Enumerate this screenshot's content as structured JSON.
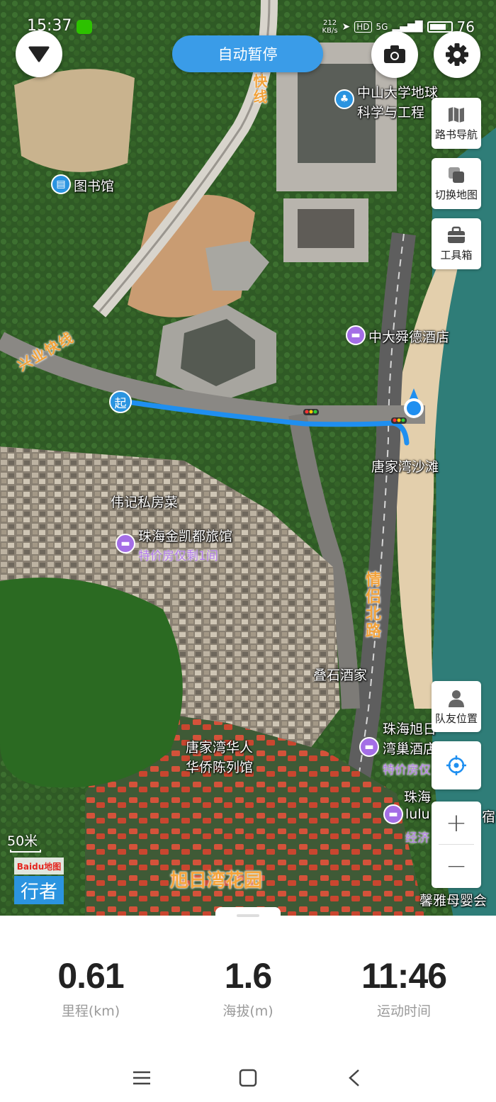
{
  "status_bar": {
    "time": "15:37",
    "net_speed": "212\nKB/s",
    "hd": "HD",
    "network": "5G",
    "battery": "76"
  },
  "top": {
    "pause_label": "自动暂停"
  },
  "side_tools": {
    "roadbook": "路书导航",
    "switch_map": "切换地图",
    "toolbox": "工具箱",
    "teammate": "队友位置"
  },
  "map": {
    "labels": {
      "library": "图书馆",
      "sysu_line1": "中山大学地球",
      "sysu_line2": "科学与工程",
      "express": "快线",
      "xingye": "兴业快线",
      "hotel_shunde": "中大舜德酒店",
      "start_marker": "起",
      "beach": "唐家湾沙滩",
      "weiji": "伟记私房菜",
      "jinkaidu": "珠海金凯都旅馆",
      "jinkaidu_offer": "特价房仅剩1间",
      "qinglv_road": "情侣北路",
      "dieshi": "叠石酒家",
      "xuri_hotel_1": "珠海旭日",
      "xuri_hotel_2": "湾巢酒店",
      "xuri_offer": "特价房仅",
      "museum_line1": "唐家湾华人",
      "museum_line2": "华侨陈列馆",
      "lulu_1": "珠海",
      "lulu_2": "lulu",
      "lulu_3": "宿",
      "lulu_offer": "经济",
      "garden": "旭日湾花园",
      "baby": "馨雅母婴会"
    },
    "scale": "50米",
    "brand_top": "Baidu地图",
    "brand_bottom": "行者"
  },
  "stats": [
    {
      "value": "0.61",
      "caption": "里程(km)"
    },
    {
      "value": "1.6",
      "caption": "海拔(m)"
    },
    {
      "value": "11:46",
      "caption": "运动时间"
    }
  ],
  "icons": {
    "dropdown": "triangle-down-icon",
    "camera": "camera-icon",
    "settings": "gear-icon",
    "locate": "crosshair-icon"
  },
  "colors": {
    "accent": "#3a9ce8",
    "route": "#1f8ff0",
    "hotel_poi": "#a46ee6"
  }
}
